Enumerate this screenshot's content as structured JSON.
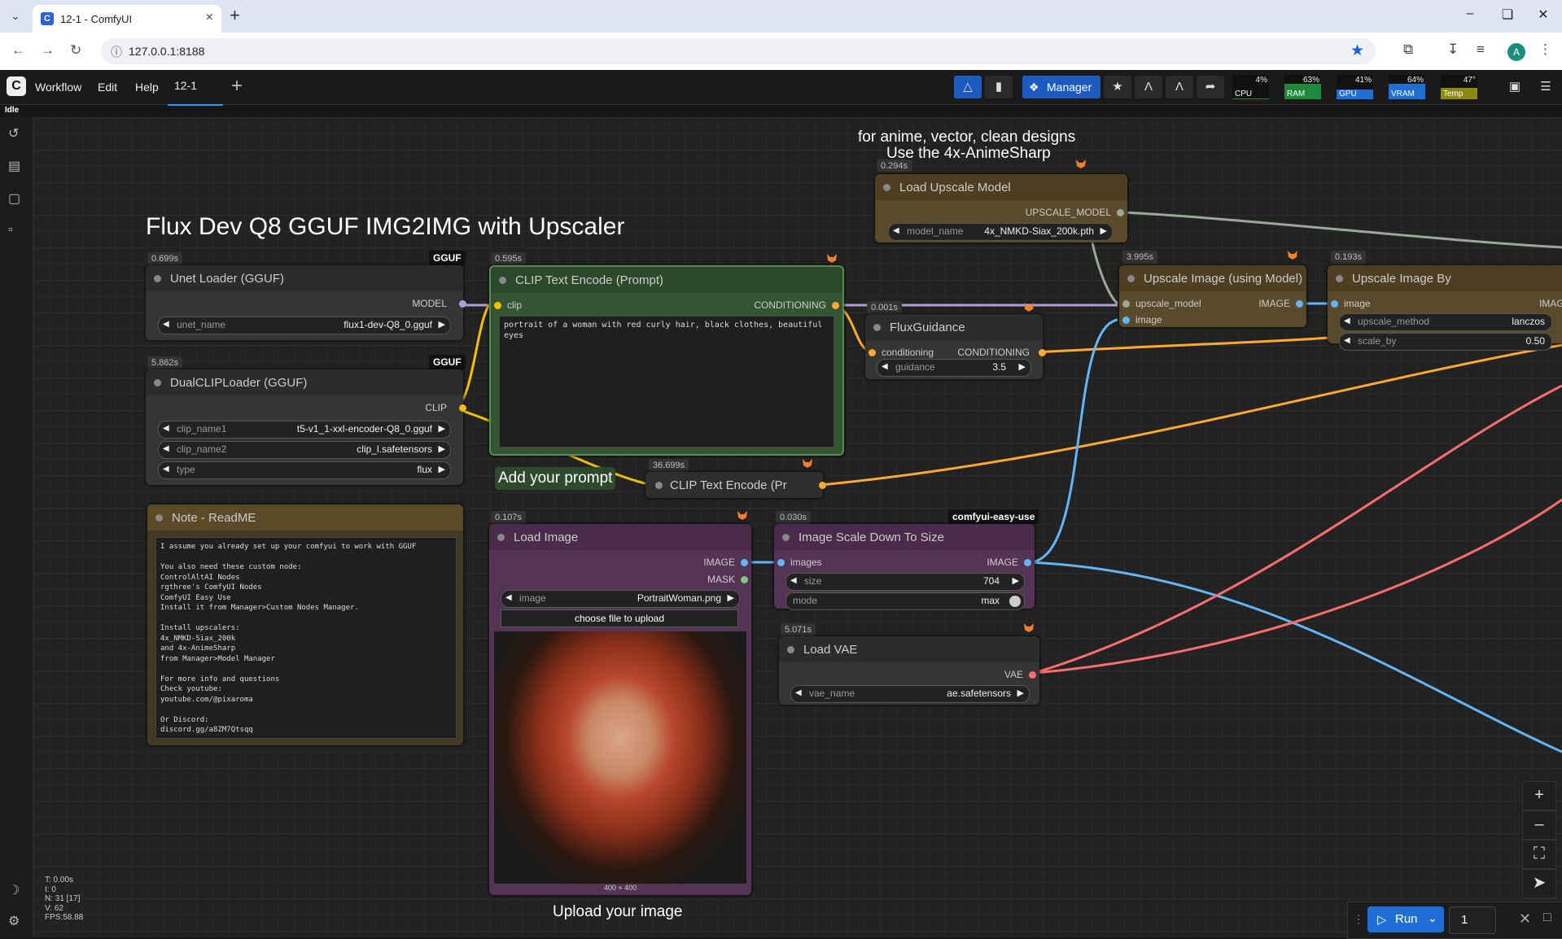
{
  "browser": {
    "tab_title": "12-1 - ComfyUI",
    "url": "127.0.0.1:8188"
  },
  "menu": {
    "items": [
      "Workflow",
      "Edit",
      "Help"
    ],
    "workflow_tab": "12-1",
    "manager_label": "Manager",
    "status": "Idle"
  },
  "monitors": [
    {
      "label": "CPU",
      "value": "4%",
      "fill": 0.04,
      "color": "#1f8a3a"
    },
    {
      "label": "RAM",
      "value": "63%",
      "fill": 0.63,
      "color": "#1f8a3a"
    },
    {
      "label": "GPU",
      "value": "41%",
      "fill": 0.41,
      "color": "#1f6fd6"
    },
    {
      "label": "VRAM",
      "value": "64%",
      "fill": 0.64,
      "color": "#1f6fd6"
    },
    {
      "label": "Temp",
      "value": "47°",
      "fill": 0.47,
      "color": "#8a8a10"
    }
  ],
  "groups": {
    "main_title": "Flux Dev Q8 GGUF IMG2IMG with Upscaler",
    "upscaler_note_line1": "for anime, vector, clean designs",
    "upscaler_note_line2": "Use the 4x-AnimeSharp",
    "prompt_label": "Add your prompt",
    "upload_label": "Upload your image"
  },
  "nodes": {
    "unet": {
      "title": "Unet Loader (GGUF)",
      "time": "0.699s",
      "badge": "GGUF",
      "out": "MODEL",
      "w_label": "unet_name",
      "w_value": "flux1-dev-Q8_0.gguf"
    },
    "dualclip": {
      "title": "DualCLIPLoader (GGUF)",
      "time": "5.862s",
      "badge": "GGUF",
      "out": "CLIP",
      "widgets": [
        {
          "label": "clip_name1",
          "value": "t5-v1_1-xxl-encoder-Q8_0.gguf"
        },
        {
          "label": "clip_name2",
          "value": "clip_l.safetensors"
        },
        {
          "label": "type",
          "value": "flux"
        }
      ]
    },
    "clip_encode": {
      "title": "CLIP Text Encode (Prompt)",
      "time": "0.595s",
      "in": "clip",
      "out": "CONDITIONING",
      "text": "portrait of a woman with red curly hair, black clothes, beautiful eyes"
    },
    "flux_guidance": {
      "title": "FluxGuidance",
      "time": "0.001s",
      "in": "conditioning",
      "out": "CONDITIONING",
      "w_label": "guidance",
      "w_value": "3.5"
    },
    "clip_encode2": {
      "title": "CLIP Text Encode (Pr",
      "time": "36.699s"
    },
    "note": {
      "title": "Note - ReadME",
      "text": "I assume you already set up your comfyui to work with GGUF\n\nYou also need these custom node:\nControlAltAI Nodes\nrgthree's ComfyUI Nodes\nComfyUI Easy Use\nInstall it from Manager>Custom Nodes Manager.\n\nInstall upscalers:\n4x_NMKD-Siax_200k\nand 4x-AnimeSharp\nfrom Manager>Model Manager\n\nFor more info and questions\nCheck youtube:\nyoutube.com/@pixaroma\n\nOr Discord:\ndiscord.gg/a8ZM7Qtsqq"
    },
    "load_image": {
      "title": "Load Image",
      "time": "0.107s",
      "out1": "IMAGE",
      "out2": "MASK",
      "w_label": "image",
      "w_value": "PortraitWoman.png",
      "upload_label": "choose file to upload",
      "dims": "400 × 400"
    },
    "scale_down": {
      "title": "Image Scale Down To Size",
      "time": "0.030s",
      "badge": "comfyui-easy-use",
      "in": "images",
      "out": "IMAGE",
      "w1_label": "size",
      "w1_value": "704",
      "w2_label": "mode",
      "w2_value": "max"
    },
    "load_vae": {
      "title": "Load VAE",
      "time": "5.071s",
      "out": "VAE",
      "w_label": "vae_name",
      "w_value": "ae.safetensors"
    },
    "load_upscale": {
      "title": "Load Upscale Model",
      "time": "0.294s",
      "out": "UPSCALE_MODEL",
      "w_label": "model_name",
      "w_value": "4x_NMKD-Siax_200k.pth"
    },
    "upscale_model": {
      "title": "Upscale Image (using Model)",
      "time": "3.995s",
      "in1": "upscale_model",
      "in2": "image",
      "out": "IMAGE"
    },
    "upscale_by": {
      "title": "Upscale Image By",
      "time": "0.193s",
      "in": "image",
      "out": "IMAG",
      "w1_label": "upscale_method",
      "w1_value": "lanczos",
      "w2_label": "scale_by",
      "w2_value": "0.50"
    }
  },
  "stats": {
    "t": "T: 0.00s",
    "i": "I: 0",
    "n": "N: 31 [17]",
    "v": "V: 62",
    "fps": "FPS:58.88"
  },
  "run": {
    "label": "Run",
    "count": "1"
  }
}
